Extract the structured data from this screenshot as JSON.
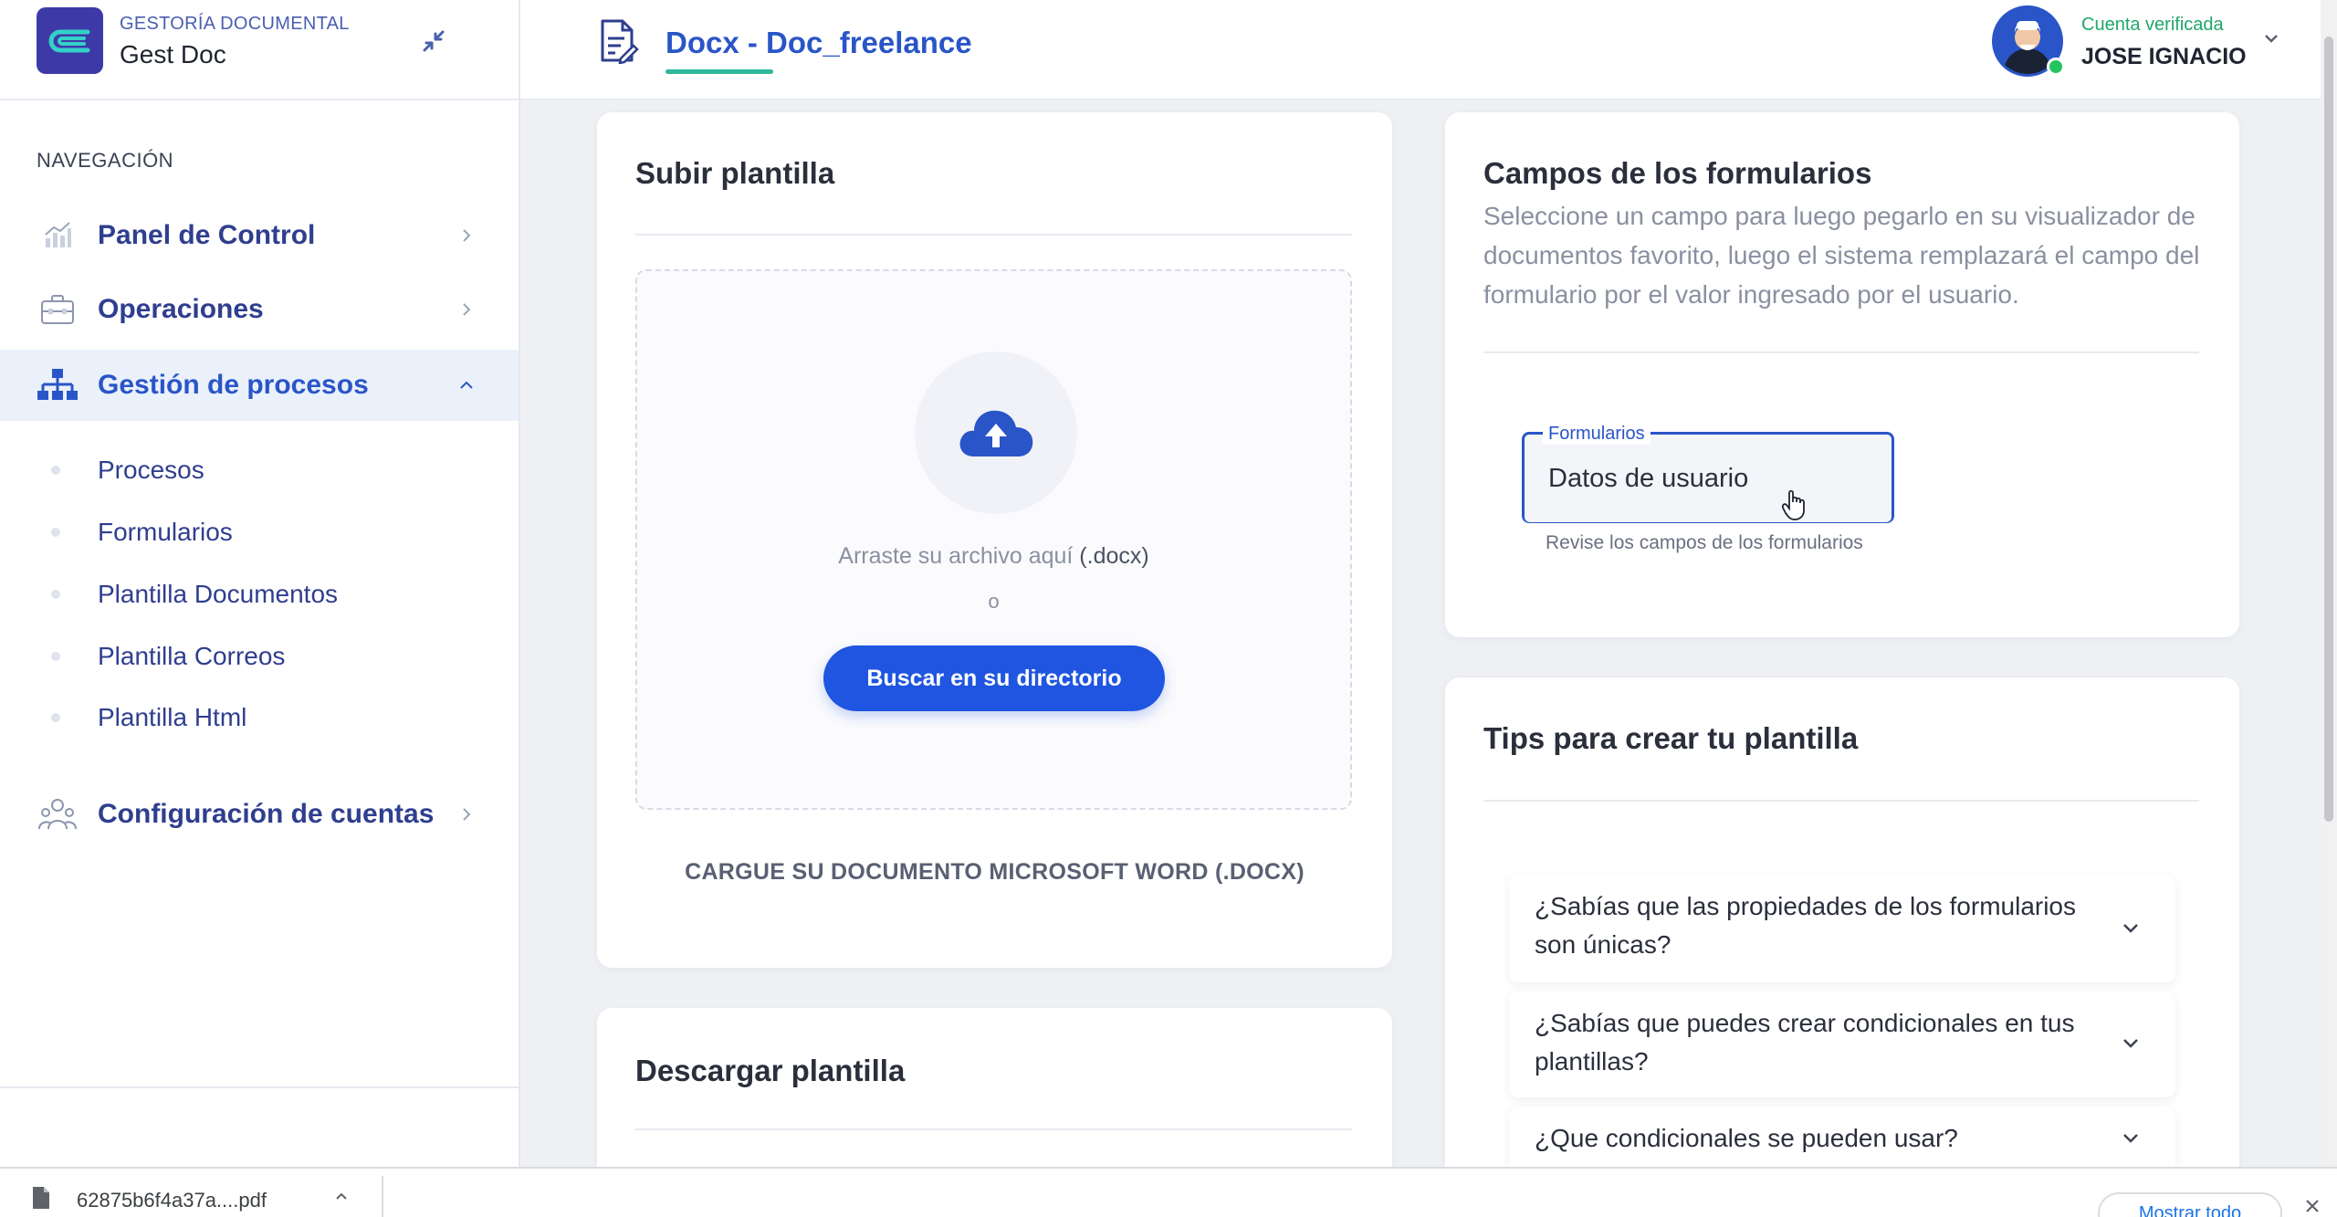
{
  "brand": {
    "subtitle": "GESTORÍA DOCUMENTAL",
    "title": "Gest Doc"
  },
  "sidebar": {
    "heading": "NAVEGACIÓN",
    "items": [
      {
        "label": "Panel de Control",
        "icon": "chart-icon"
      },
      {
        "label": "Operaciones",
        "icon": "briefcase-icon"
      },
      {
        "label": "Gestión de procesos",
        "icon": "org-chart-icon",
        "expanded": true
      },
      {
        "label": "Configuración de cuentas",
        "icon": "users-icon"
      }
    ],
    "subitems": [
      "Procesos",
      "Formularios",
      "Plantilla Documentos",
      "Plantilla Correos",
      "Plantilla Html"
    ]
  },
  "header": {
    "doc_title": "Docx - Doc_freelance",
    "user": {
      "status": "Cuenta verificada",
      "name": "JOSE IGNACIO"
    }
  },
  "upload_card": {
    "title": "Subir plantilla",
    "drop_text": "Arraste su archivo aquí ",
    "drop_ext": "(.docx)",
    "or": "o",
    "button": "Buscar en su directorio",
    "caption": "CARGUE SU DOCUMENTO MICROSOFT WORD (.DOCX)"
  },
  "download_card": {
    "title": "Descargar plantilla"
  },
  "fields_card": {
    "title": "Campos de los formularios",
    "description": "Seleccione un campo para luego pegarlo en su visualizador de documentos favorito, luego el sistema remplazará el campo del formulario por el valor ingresado por el usuario.",
    "select_label": "Formularios",
    "select_value": "Datos de usuario",
    "helper": "Revise los campos de los formularios"
  },
  "tips_card": {
    "title": "Tips para crear tu plantilla",
    "items": [
      "¿Sabías que las propiedades de los formularios son únicas?",
      "¿Sabías que puedes crear condicionales en tus plantillas?",
      "¿Que condicionales se pueden usar?"
    ]
  },
  "download_bar": {
    "file_name": "62875b6f4a37a....pdf",
    "show_all": "Mostrar todo"
  },
  "colors": {
    "primary": "#2a55c8",
    "button": "#1f55e0",
    "accent_underline": "#2fb89a",
    "verified": "#20a86a"
  }
}
